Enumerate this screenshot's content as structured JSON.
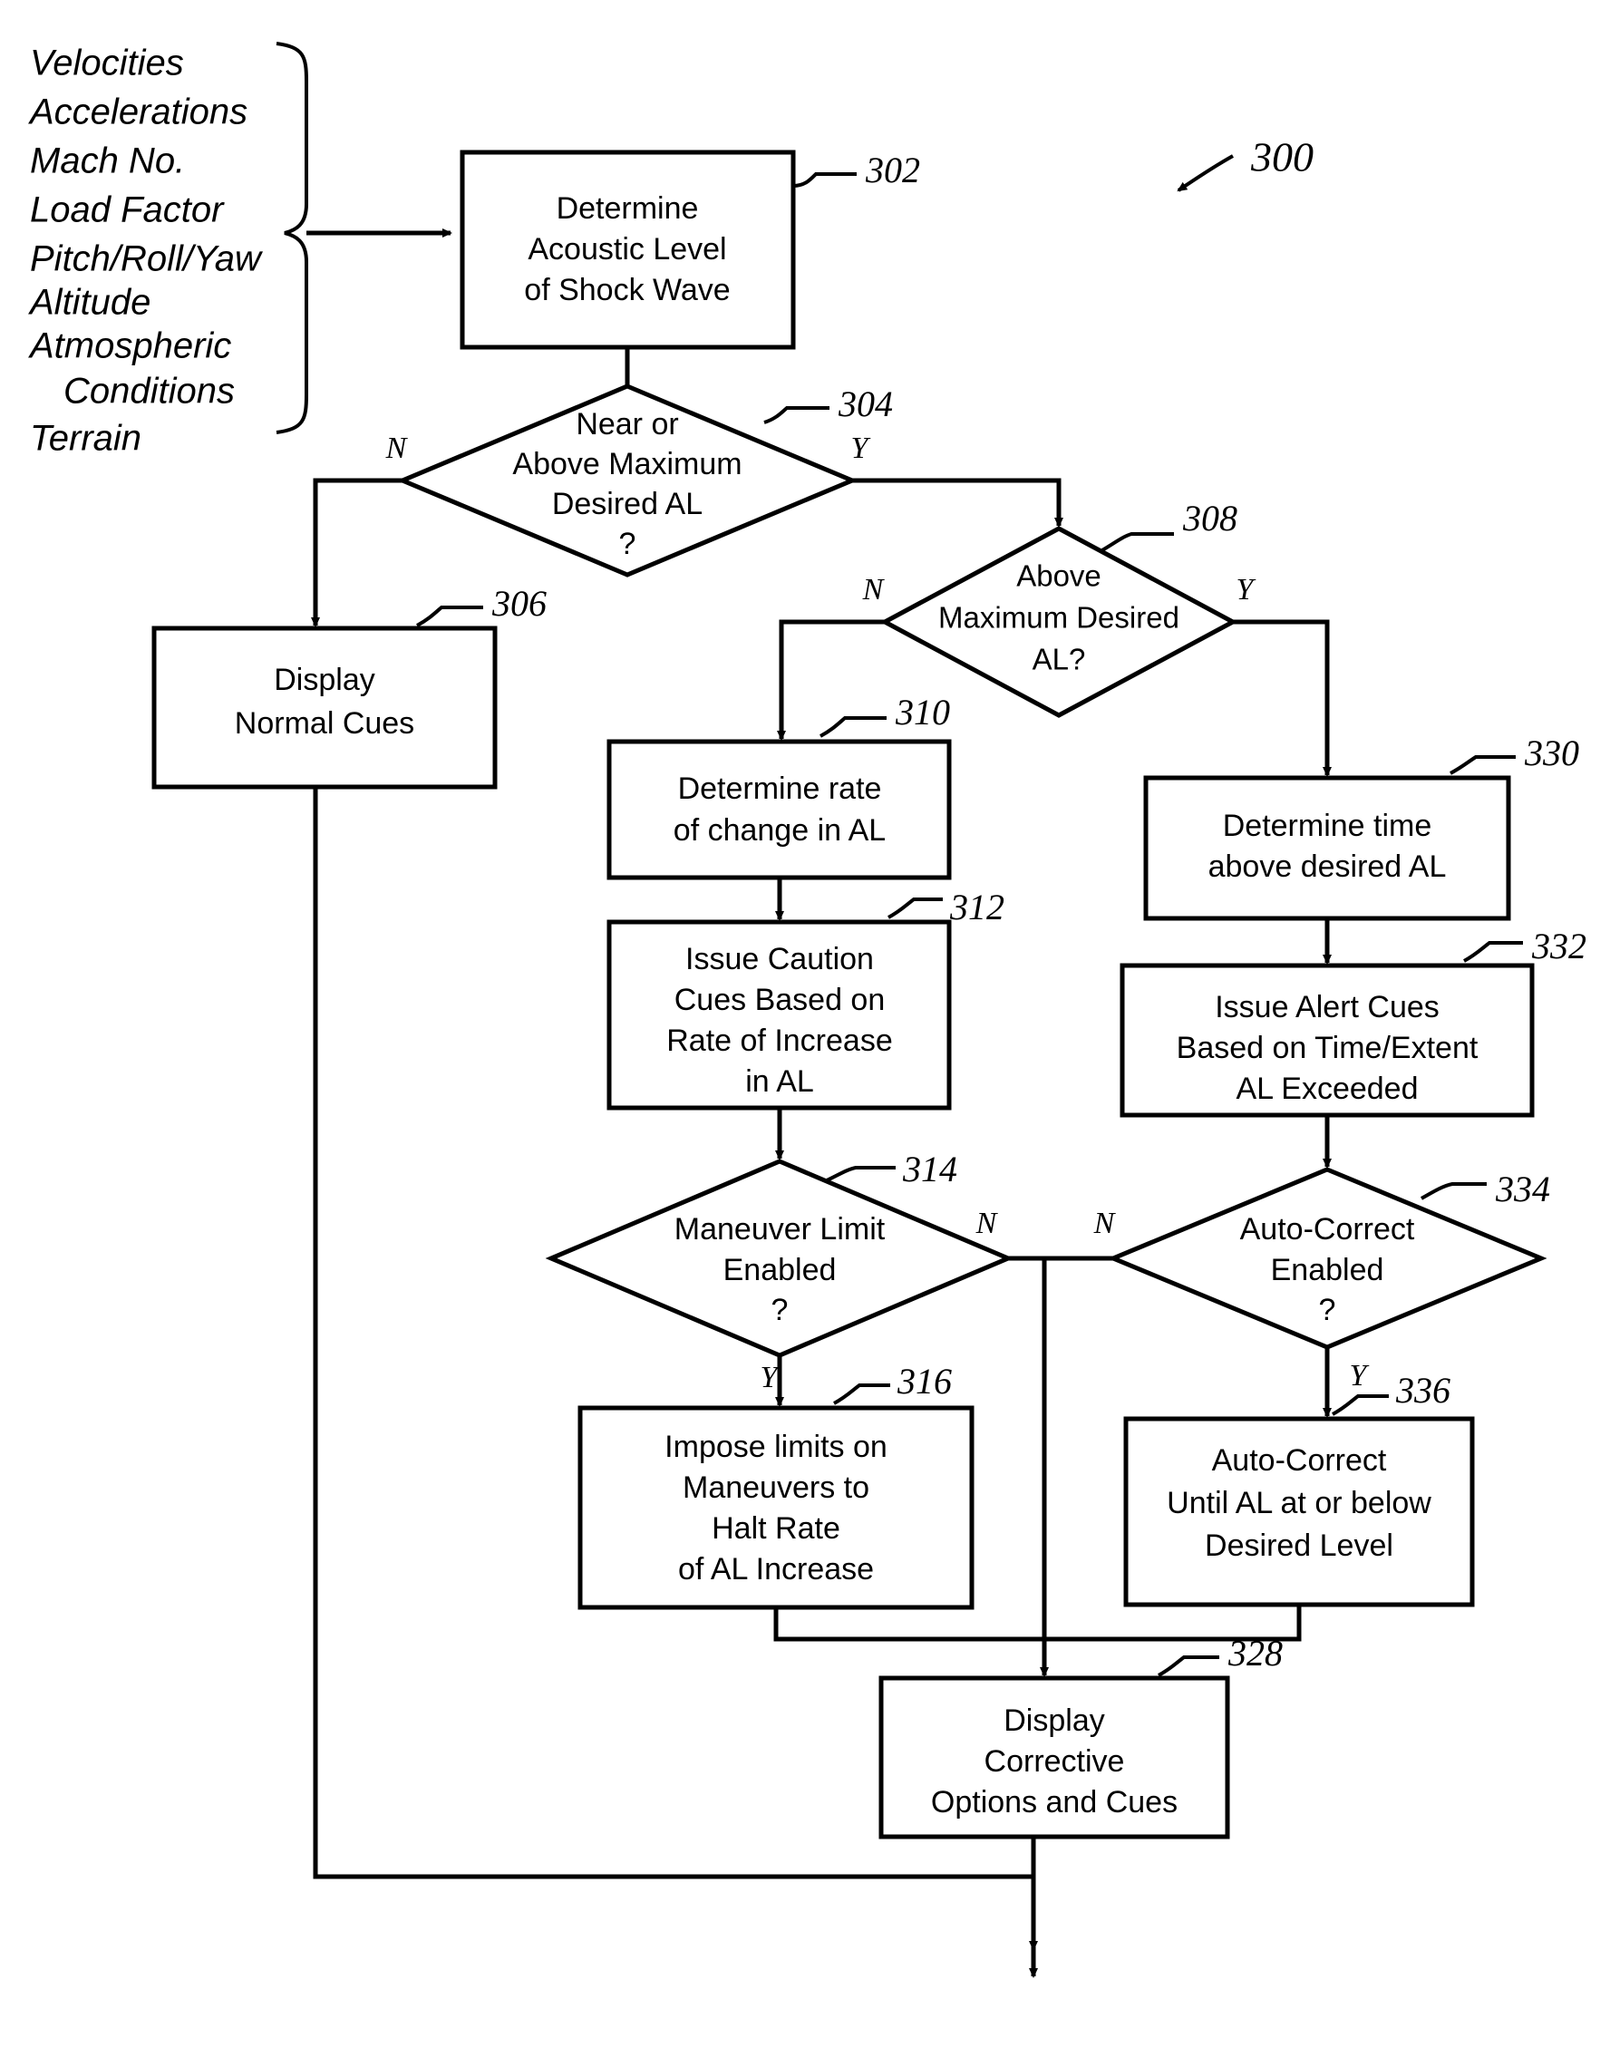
{
  "figure": {
    "figure_ref": "300",
    "inputs": [
      "Velocities",
      "Accelerations",
      "Mach No.",
      "Load Factor",
      "Pitch/Roll/Yaw",
      "Altitude",
      "Atmospheric",
      "Conditions",
      "Terrain"
    ],
    "nodes": {
      "n302": {
        "ref": "302",
        "type": "process",
        "lines": [
          "Determine",
          "Acoustic Level",
          "of Shock Wave"
        ]
      },
      "n304": {
        "ref": "304",
        "type": "decision",
        "lines": [
          "Near or",
          "Above Maximum",
          "Desired AL",
          "?"
        ],
        "branch_no": "N",
        "branch_yes": "Y"
      },
      "n306": {
        "ref": "306",
        "type": "process",
        "lines": [
          "Display",
          "Normal Cues"
        ]
      },
      "n308": {
        "ref": "308",
        "type": "decision",
        "lines": [
          "Above",
          "Maximum Desired",
          "AL?"
        ],
        "branch_no": "N",
        "branch_yes": "Y"
      },
      "n310": {
        "ref": "310",
        "type": "process",
        "lines": [
          "Determine rate",
          "of change in AL"
        ]
      },
      "n312": {
        "ref": "312",
        "type": "process",
        "lines": [
          "Issue Caution",
          "Cues Based on",
          "Rate of Increase",
          "in AL"
        ]
      },
      "n314": {
        "ref": "314",
        "type": "decision",
        "lines": [
          "Maneuver Limit",
          "Enabled",
          "?"
        ],
        "branch_no": "N",
        "branch_yes": "Y"
      },
      "n316": {
        "ref": "316",
        "type": "process",
        "lines": [
          "Impose limits on",
          "Maneuvers to",
          "Halt Rate",
          "of AL Increase"
        ]
      },
      "n328": {
        "ref": "328",
        "type": "process",
        "lines": [
          "Display",
          "Corrective",
          "Options and Cues"
        ]
      },
      "n330": {
        "ref": "330",
        "type": "process",
        "lines": [
          "Determine time",
          "above desired AL"
        ]
      },
      "n332": {
        "ref": "332",
        "type": "process",
        "lines": [
          "Issue Alert Cues",
          "Based on Time/Extent",
          "AL Exceeded"
        ]
      },
      "n334": {
        "ref": "334",
        "type": "decision",
        "lines": [
          "Auto-Correct",
          "Enabled",
          "?"
        ],
        "branch_no": "N",
        "branch_yes": "Y"
      },
      "n336": {
        "ref": "336",
        "type": "process",
        "lines": [
          "Auto-Correct",
          "Until AL at or below",
          "Desired Level"
        ]
      }
    },
    "colors": {
      "ink": "#000000",
      "paper": "#ffffff"
    }
  }
}
